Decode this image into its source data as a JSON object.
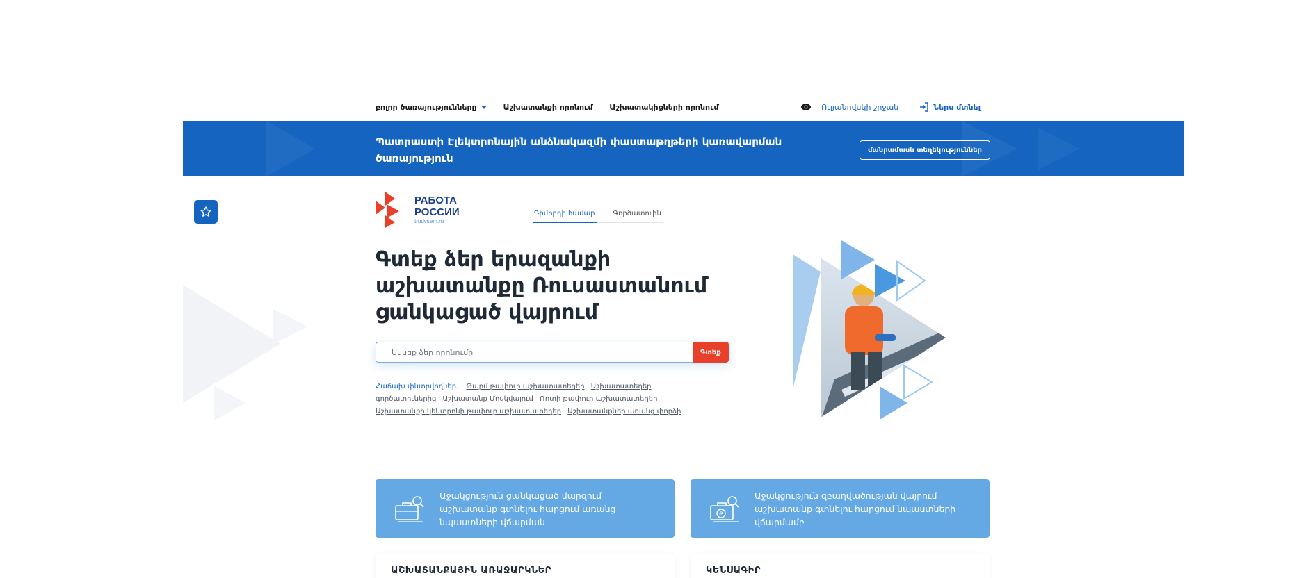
{
  "nav": {
    "all_services": "բոլոր ծառայությունները",
    "job_search": "Աշխատանքի որոնում",
    "employee_search": "Աշխատակիցների որոնում",
    "accessibility": "Ուլյանովսկի շրջան",
    "login": "Ներս մտնել"
  },
  "banner": {
    "title": "Պատրաստի Էլեկտրոնային անձնակազմի փաստաթղթերի կառավարման ծառայություն",
    "more_button": "մանրամասն տեղեկություններ"
  },
  "logo": {
    "line1": "РАБОТА",
    "line2": "РОССИИ",
    "domain": "trudvsem.ru"
  },
  "tabs": [
    {
      "label": "Դիմորդի համար",
      "active": true
    },
    {
      "label": "Գործատուին",
      "active": false
    }
  ],
  "hero": {
    "title": "Գտեք ձեր երազանքի աշխատանքը Ռուսաստանում ցանկացած վայրում",
    "search_placeholder": "Սկսեք ձեր որոնումը",
    "search_button": "Գտեք"
  },
  "popular": {
    "lead": "Հաճախ փնտրվողներ.",
    "links": [
      "Թարմ թափուր աշխատատեղեր",
      "Աշխատատեղեր գործատուներից",
      "Աշխատանք Մոսկվայում",
      "Ռոտի թափուր աշխատատեղեր",
      "Աշխատանքի կենտրոնի թափուր աշխատատեղեր",
      "Աշխատանքներ առանց փորձի"
    ]
  },
  "cards": [
    {
      "text": "Աջակցություն ցանկացած մարզում աշխատանք գտնելու հարցում առանց նպաստների վճարման",
      "icon": "briefcase-search-icon"
    },
    {
      "text": "Աջակցություն զբաղվածության վայրում աշխատանք գտնելու հարցում նպաստների վճարմամբ",
      "icon": "briefcase-ruble-icon"
    }
  ],
  "cards_bottom": [
    {
      "title": "ԱՇԽԱՏԱՆՔԱՅԻՆ ԱՌԱՋԱՐԿՆԵՐ"
    },
    {
      "title": "ԿԵՆՍԱԳԻՐ"
    }
  ],
  "colors": {
    "brand_blue": "#1565c0",
    "card_blue": "#64a9e3",
    "search_red": "#e8412b"
  }
}
